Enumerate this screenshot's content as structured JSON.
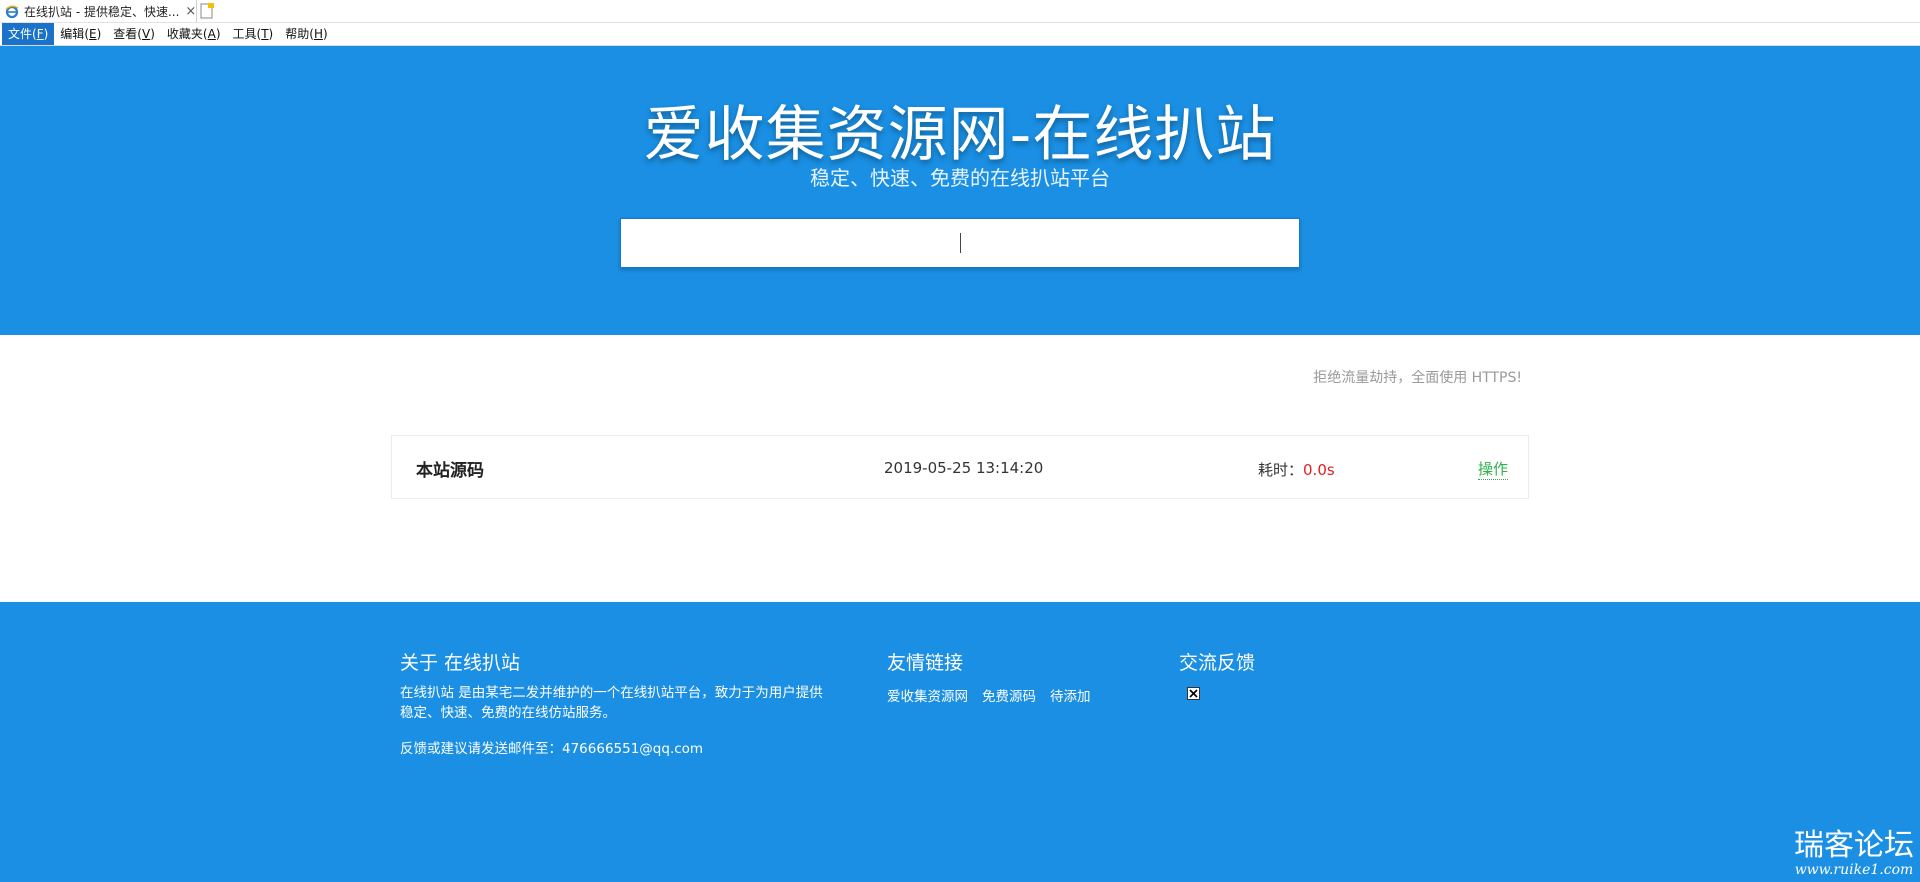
{
  "browser": {
    "tab_title": "在线扒站 - 提供稳定、快速...",
    "tab_close": "×",
    "menu": [
      {
        "label": "文件",
        "key": "F"
      },
      {
        "label": "编辑",
        "key": "E"
      },
      {
        "label": "查看",
        "key": "V"
      },
      {
        "label": "收藏夹",
        "key": "A"
      },
      {
        "label": "工具",
        "key": "T"
      },
      {
        "label": "帮助",
        "key": "H"
      }
    ]
  },
  "hero": {
    "title": "爱收集资源网-在线扒站",
    "subtitle": "稳定、快速、免费的在线扒站平台",
    "search": {
      "value": "",
      "placeholder": ""
    },
    "background": "#1a8fe3"
  },
  "main": {
    "notice": "拒绝流量劫持，全面使用 HTTPS!",
    "record": {
      "name": "本站源码",
      "time": "2019-05-25 13:14:20",
      "cost_label": "耗时：",
      "cost_value": "0.0s",
      "action": "操作"
    }
  },
  "footer": {
    "about": {
      "title": "关于 在线扒站",
      "text": "在线扒站 是由某宅二发并维护的一个在线扒站平台，致力于为用户提供稳定、快速、免费的在线仿站服务。",
      "mail": "反馈或建议请发送邮件至：476666551@qq.com"
    },
    "links": {
      "title": "友情链接",
      "items": [
        "爱收集资源网",
        "免费源码",
        "待添加"
      ]
    },
    "feedback": {
      "title": "交流反馈",
      "icon": "broken-image-icon"
    }
  },
  "watermark": {
    "main": "瑞客论坛",
    "sub": "www.ruike1.com"
  }
}
